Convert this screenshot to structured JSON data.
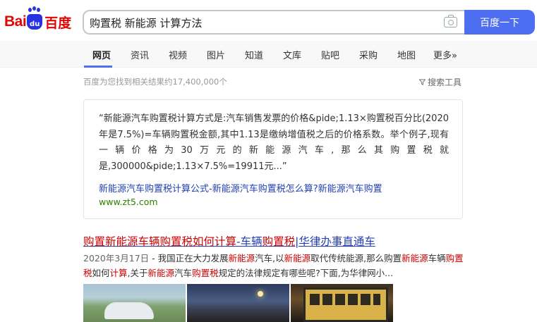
{
  "logo": {
    "text_bai": "Bai",
    "text_du": "du",
    "text_cn": "百度"
  },
  "search": {
    "query": "购置税 新能源 计算方法",
    "button_label": "百度一下"
  },
  "tabs": [
    {
      "label": "网页",
      "active": true
    },
    {
      "label": "资讯"
    },
    {
      "label": "视频"
    },
    {
      "label": "图片"
    },
    {
      "label": "知道"
    },
    {
      "label": "文库"
    },
    {
      "label": "贴吧"
    },
    {
      "label": "采购"
    },
    {
      "label": "地图"
    },
    {
      "label": "更多»"
    }
  ],
  "results_info": {
    "count_text": "百度为您找到相关结果约17,400,000个",
    "tools_label": "搜索工具"
  },
  "answer_card": {
    "text": "“新能源汽车购置税计算方式是:汽车销售发票的价格&pide;1.13×购置税百分比(2020年是7.5%)=车辆购置税金额,其中1.13是缴纳增值税之后的价格系数。举个例子,现有一辆价格为30万元的新能源汽车,那么其购置税就是,300000&pide;1.13×7.5%=19911元...”",
    "link_text": "新能源汽车购置税计算公式-新能源汽车购置税怎么算?新能源汽车购置",
    "site": "www.zt5.com"
  },
  "result2": {
    "title_segments": [
      {
        "text": "购置新能源车辆购置税如何计算",
        "em": true
      },
      {
        "text": "-车辆",
        "em": false
      },
      {
        "text": "购置税",
        "em": true
      },
      {
        "text": "|华律办事直通车",
        "em": false
      }
    ],
    "date": "2020年3月17日",
    "desc_segments": [
      {
        "text": " - 我国正在大力发展",
        "em": false
      },
      {
        "text": "新能源",
        "em": true
      },
      {
        "text": "汽车,以",
        "em": false
      },
      {
        "text": "新能源",
        "em": true
      },
      {
        "text": "取代传统能源,那么购置",
        "em": false
      },
      {
        "text": "新能源",
        "em": true
      },
      {
        "text": "车辆",
        "em": false
      },
      {
        "text": "购置税",
        "em": true
      },
      {
        "text": "如何",
        "em": false
      },
      {
        "text": "计算",
        "em": true
      },
      {
        "text": ",关于",
        "em": false
      },
      {
        "text": "新能源",
        "em": true
      },
      {
        "text": "汽车",
        "em": false
      },
      {
        "text": "购置税",
        "em": true
      },
      {
        "text": "规定的法律规定有哪些呢?下面,为华律网小...",
        "em": false
      }
    ]
  },
  "icons": {
    "camera": "camera-icon",
    "filter": "filter-icon"
  },
  "colors": {
    "accent": "#4e6ef2",
    "link": "#2440b3",
    "highlight": "#c00000",
    "site_url": "#2b7f00",
    "logo_red": "#e10601",
    "logo_blue": "#2932e1"
  }
}
